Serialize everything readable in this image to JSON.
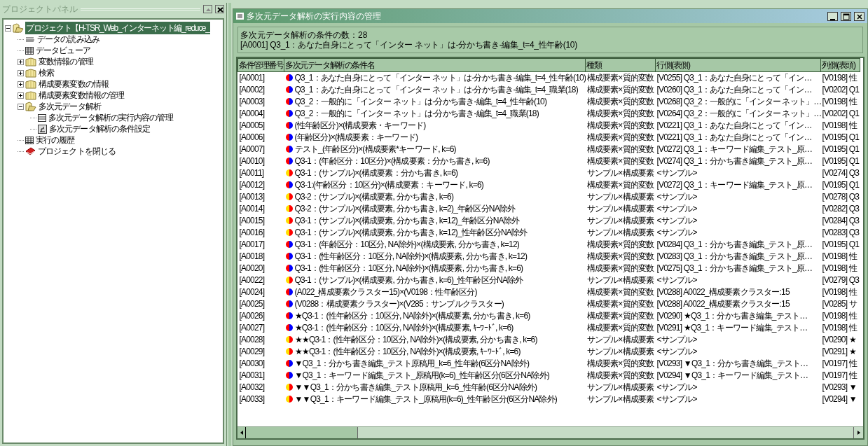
{
  "project_panel": {
    "title": "プロジェクトパネル",
    "tree": [
      {
        "label": "プロジェクト【H-TSR_Web_インターネット編_reduce_",
        "kind": "folder",
        "expanded": true,
        "selected": true,
        "children": [
          {
            "label": "データの読み込み",
            "kind": "import",
            "selected": false
          },
          {
            "label": "データビューア",
            "kind": "table",
            "selected": false
          },
          {
            "label": "変数情報の管理",
            "kind": "folder",
            "expanded": false,
            "selected": false
          },
          {
            "label": "検索",
            "kind": "folder",
            "expanded": false,
            "selected": false
          },
          {
            "label": "構成要素変数の情報",
            "kind": "folder",
            "expanded": false,
            "selected": false
          },
          {
            "label": "構成要素変数情報の管理",
            "kind": "folder",
            "expanded": false,
            "selected": false
          },
          {
            "label": "多次元データ解析",
            "kind": "folder",
            "expanded": true,
            "selected": false,
            "children": [
              {
                "label": "多次元データ解析の実行内容の管理",
                "kind": "list",
                "selected": false
              },
              {
                "label": "多次元データ解析の条件設定",
                "kind": "chart",
                "selected": false
              }
            ]
          },
          {
            "label": "実行の履歴",
            "kind": "table",
            "selected": false
          },
          {
            "label": "プロジェクトを閉じる",
            "kind": "close",
            "selected": false
          }
        ]
      }
    ]
  },
  "window": {
    "title": "多次元データ解析の実行内容の管理",
    "count": "多次元データ解析の条件の数：28",
    "current": "[A0001] Q3_1：あなた自身にとって「インター ネット」は-分かち書き-編集_t=4_性年齢(10)",
    "table": {
      "columns": [
        "条件管理番号",
        "多次元データ解析の条件名",
        "種類",
        "行側(表側)",
        "列側(表頭)"
      ],
      "rows": [
        {
          "kind": "qualitative",
          "cells": [
            "[A0001]",
            "Q3_1：あなた自身にとって「インター ネット」は-分かち書き-編集_t=4_性年齢(10)",
            "構成要素×質的変数",
            "[V0255] Q3_1：あなた自身にとって「イン…",
            "[V0198] 性"
          ]
        },
        {
          "kind": "qualitative",
          "cells": [
            "[A0002]",
            "Q3_1：あなた自身にとって「インター ネット」は-分かち書き-編集_t=4_職業(18)",
            "構成要素×質的変数",
            "[V0260] Q3_1：あなた自身にとって「イン…",
            "[V0202] Q1"
          ]
        },
        {
          "kind": "qualitative",
          "cells": [
            "[A0003]",
            "Q3_2：一般的に「インター ネット」は-分かち書き-編集_t=4_性年齢(10)",
            "構成要素×質的変数",
            "[V0268] Q3_2：一般的に「インター ネット」…",
            "[V0198] 性"
          ]
        },
        {
          "kind": "qualitative",
          "cells": [
            "[A0004]",
            "Q3_2：一般的に「インター ネット」は-分かち書き-編集_t=4_職業(18)",
            "構成要素×質的変数",
            "[V0264] Q3_2：一般的に「インター ネット」…",
            "[V0202] Q1"
          ]
        },
        {
          "kind": "qualitative",
          "cells": [
            "[A0005]",
            "(性年齢区分)×(構成要素・キーワード)",
            "構成要素×質的変数",
            "[V0221] Q3_1：あなた自身にとって「イン…",
            "[V0198] 性"
          ]
        },
        {
          "kind": "qualitative",
          "cells": [
            "[A0006]",
            "(年齢区分)×(構成要素：キーワード)",
            "構成要素×質的変数",
            "[V0221] Q3_1：あなた自身にとって「イン…",
            "[V0195] Q1"
          ]
        },
        {
          "kind": "qualitative",
          "cells": [
            "[A0007]",
            "テスト_(年齢区分)×(構成要素*キーワード, k=6)",
            "構成要素×質的変数",
            "[V0272] Q3_1：キーワード編集_テスト_原…",
            "[V0195] Q1"
          ]
        },
        {
          "kind": "qualitative",
          "cells": [
            "[A0010]",
            "Q3-1：(年齢区分：10区分)×(構成要素：分かち書き, k=6)",
            "構成要素×質的変数",
            "[V0274] Q3_1：分かち書き編集_テスト_原…",
            "[V0195] Q1"
          ]
        },
        {
          "kind": "sample",
          "cells": [
            "[A0011]",
            "Q3-1：(サンプル)×(構成要素：分かち書き, k=6)",
            "サンプル×構成要素",
            "<サンプル>",
            "[V0274] Q3"
          ]
        },
        {
          "kind": "qualitative",
          "cells": [
            "[A0012]",
            "Q3-1:(年齢区分：10区分)×(構成要素：キーワード, k=6)",
            "構成要素×質的変数",
            "[V0272] Q3_1：キーワード編集_テスト_原…",
            "[V0195] Q1"
          ]
        },
        {
          "kind": "sample",
          "cells": [
            "[A0013]",
            "Q3-2：(サンプル)×(構成要素, 分かち書き, k=6)",
            "サンプル×構成要素",
            "<サンプル>",
            "[V0278] Q3"
          ]
        },
        {
          "kind": "sample",
          "cells": [
            "[A0014]",
            "Q3-2：(サンプル)×(構成要素, 分かち書き, k=2)_年齢区分NA除外",
            "サンプル×構成要素",
            "<サンプル>",
            "[V0282] Q3"
          ]
        },
        {
          "kind": "sample",
          "cells": [
            "[A0015]",
            "Q3-1：(サンプル)×(構成要素, 分かち書き, k=12)_年齢区分NA除外",
            "サンプル×構成要素",
            "<サンプル>",
            "[V0284] Q3"
          ]
        },
        {
          "kind": "sample",
          "cells": [
            "[A0016]",
            "Q3-1：(サンプル)×(構成要素, 分かち書き, k=12)_性年齢区分NA除外",
            "サンプル×構成要素",
            "<サンプル>",
            "[V0283] Q3"
          ]
        },
        {
          "kind": "qualitative",
          "cells": [
            "[A0017]",
            "Q3-1：(年齢区分：10区分, NA除外)×(構成要素, 分かち書き, k=12)",
            "構成要素×質的変数",
            "[V0284] Q3_1：分かち書き編集_テスト_原…",
            "[V0195] Q1"
          ]
        },
        {
          "kind": "qualitative",
          "cells": [
            "[A0018]",
            "Q3-1：(性年齢区分：10区分, NA除外)×(構成要素, 分かち書き, k=12)",
            "構成要素×質的変数",
            "[V0283] Q3_1：分かち書き編集_テスト_原…",
            "[V0198] 性"
          ]
        },
        {
          "kind": "qualitative",
          "cells": [
            "[A0020]",
            "Q3-1：(性年齢区分：10区分, NA除外)×(構成要素, 分かち書き, k=6)",
            "構成要素×質的変数",
            "[V0275] Q3_1：分かち書き編集_テスト_原…",
            "[V0198] 性"
          ]
        },
        {
          "kind": "sample",
          "cells": [
            "[A0022]",
            "Q3-1：(サンプル)×(構成要素, 分かち書き, k=6)_性年齢区分NA除外",
            "サンプル×構成要素",
            "<サンプル>",
            "[V0279] Q3"
          ]
        },
        {
          "kind": "qualitative",
          "cells": [
            "[A0024]",
            "(A022_構成要素クラスター15)×(V0198：性年齢区分)",
            "構成要素×質的変数",
            "[V0288] A0022_構成要素クラスター:15",
            "[V0198] 性"
          ]
        },
        {
          "kind": "qualitative",
          "cells": [
            "[A0025]",
            "(V0288：構成要素クラスター)×(V285：サンプルクラスター)",
            "構成要素×質的変数",
            "[V0288] A0022_構成要素クラスター:15",
            "[V0285] サ"
          ]
        },
        {
          "kind": "qualitative",
          "cells": [
            "[A0026]",
            "★Q3-1：(性年齢区分：10区分, NA除外)×(構成要素, 分かち書き, k=6)",
            "構成要素×質的変数",
            "[V0290] ★Q3_1：分かち書き編集_テスト…",
            "[V0198] 性"
          ]
        },
        {
          "kind": "qualitative",
          "cells": [
            "[A0027]",
            "★Q3-1：(性年齢区分：10区分, NA除外)×(構成要素, ｷｰﾜｰﾄﾞ, k=6)",
            "構成要素×質的変数",
            "[V0291] ★Q3_1：キーワード編集_テスト…",
            "[V0198] 性"
          ]
        },
        {
          "kind": "sample",
          "cells": [
            "[A0028]",
            "★★Q3-1：(性年齢区分：10区分, NA除外)×(構成要素, 分かち書き, k=6)",
            "サンプル×構成要素",
            "<サンプル>",
            "[V0290] ★"
          ]
        },
        {
          "kind": "sample",
          "cells": [
            "[A0029]",
            "★★Q3-1：(性年齢区分：10区分, NA除外)×(構成要素, ｷｰﾜｰﾄﾞ, k=6)",
            "サンプル×構成要素",
            "<サンプル>",
            "[V0291] ★"
          ]
        },
        {
          "kind": "qualitative",
          "cells": [
            "[A0030]",
            "▼Q3_1：分かち書き編集_テスト原稿用_k=6_性年齢(6区分NA除外)",
            "構成要素×質的変数",
            "[V0293] ▼Q3_1：分かち書き編集_テスト…",
            "[V0197] 性"
          ]
        },
        {
          "kind": "qualitative",
          "cells": [
            "[A0031]",
            "▼Q3_1：キーワード編集_テスト_原稿用(k=6)_性年齢区分(6区分NA除外)",
            "構成要素×質的変数",
            "[V0294] ▼Q3_1：キーワード編集_テスト…",
            "[V0197] 性"
          ]
        },
        {
          "kind": "sample",
          "cells": [
            "[A0032]",
            "▼▼Q3_1：分かち書き編集_テスト原稿用_k=6_性年齢(6区分NA除外)",
            "サンプル×構成要素",
            "<サンプル>",
            "[V0293] ▼"
          ]
        },
        {
          "kind": "sample",
          "cells": [
            "[A0033]",
            "▼▼Q3_1：キーワード編集_テスト_原稿用(k=6)_性年齢区分(6区分NA除外)",
            "サンプル×構成要素",
            "<サンプル>",
            "[V0294] ▼"
          ]
        }
      ]
    }
  }
}
